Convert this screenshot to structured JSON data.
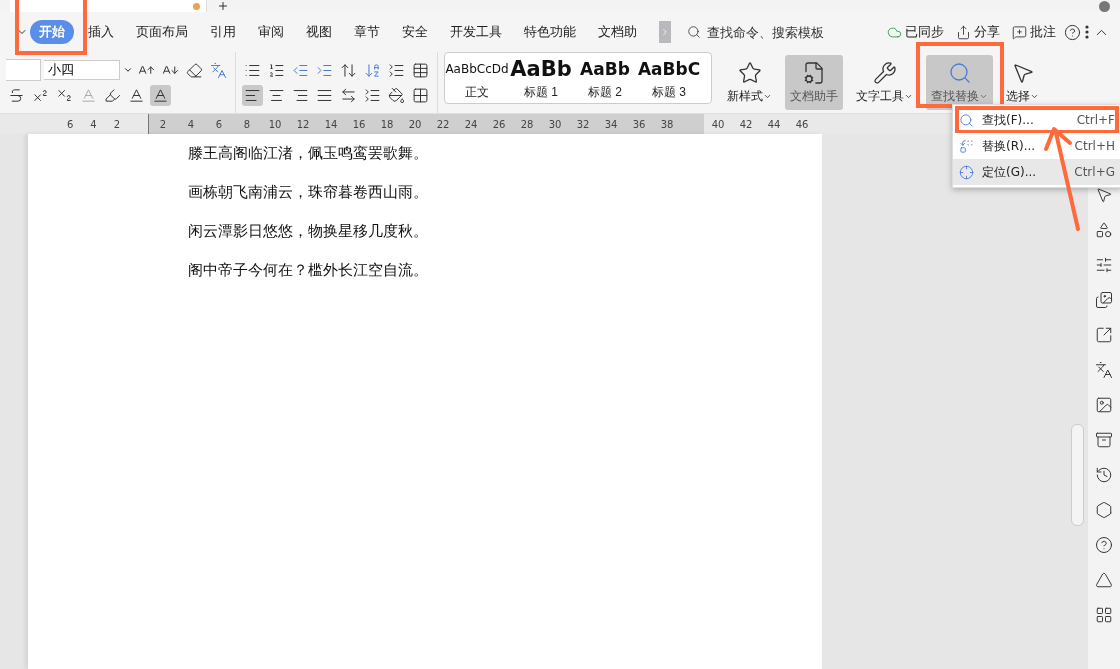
{
  "menu_tabs": [
    {
      "label": "开始",
      "selected": true,
      "highlighted": true
    },
    {
      "label": "插入",
      "selected": false,
      "highlighted": false
    },
    {
      "label": "页面布局",
      "selected": false,
      "highlighted": false
    },
    {
      "label": "引用",
      "selected": false,
      "highlighted": false
    },
    {
      "label": "审阅",
      "selected": false,
      "highlighted": false
    },
    {
      "label": "视图",
      "selected": false,
      "highlighted": false
    },
    {
      "label": "章节",
      "selected": false,
      "highlighted": false
    },
    {
      "label": "安全",
      "selected": false,
      "highlighted": false
    },
    {
      "label": "开发工具",
      "selected": false,
      "highlighted": false
    },
    {
      "label": "特色功能",
      "selected": false,
      "highlighted": false
    },
    {
      "label": "文档助",
      "selected": false,
      "highlighted": false
    }
  ],
  "search": {
    "placeholder": "查找命令、搜索模板"
  },
  "header_actions": [
    {
      "label": "已同步"
    },
    {
      "label": "分享"
    },
    {
      "label": "批注"
    }
  ],
  "font_size": {
    "value": "小四"
  },
  "alignment_buttons": [
    {
      "selected": true
    },
    {
      "selected": false
    },
    {
      "selected": false
    },
    {
      "selected": false
    },
    {
      "selected": false
    }
  ],
  "styles": [
    {
      "preview": "AaBbCcDd",
      "label": "正文",
      "kind": "body"
    },
    {
      "preview": "AaBb",
      "label": "标题 1",
      "kind": "title"
    },
    {
      "preview": "AaBb",
      "label": "标题 2",
      "kind": "heading"
    },
    {
      "preview": "AaBbC",
      "label": "标题 3",
      "kind": "heading"
    }
  ],
  "big_buttons": [
    {
      "label": "新样式",
      "selected": false,
      "highlighted": false,
      "dropdown": true
    },
    {
      "label": "文档助手",
      "selected": true,
      "highlighted": false,
      "dropdown": false
    },
    {
      "label": "文字工具",
      "selected": false,
      "highlighted": false,
      "dropdown": true
    },
    {
      "label": "查找替换",
      "selected": true,
      "highlighted": true,
      "dropdown": true
    },
    {
      "label": "选择",
      "selected": false,
      "highlighted": false,
      "dropdown": true
    }
  ],
  "ruler": {
    "left_marks": [
      "6",
      "4",
      "2"
    ],
    "marks": [
      "2",
      "4",
      "6",
      "8",
      "10",
      "12",
      "14",
      "16",
      "18",
      "20",
      "22",
      "24",
      "26",
      "28",
      "30",
      "32",
      "34",
      "36",
      "38",
      "40",
      "42",
      "44",
      "46"
    ]
  },
  "document": {
    "lines": [
      "滕王高阁临江渚，佩玉鸣鸾罢歌舞。",
      "画栋朝飞南浦云，珠帘暮卷西山雨。",
      "闲云潭影日悠悠，物换星移几度秋。",
      "阁中帝子今何在？槛外长江空自流。"
    ]
  },
  "dropdown_menu": [
    {
      "label": "查找(F)...",
      "shortcut": "Ctrl+F",
      "selected": false,
      "highlighted": true
    },
    {
      "label": "替换(R)...",
      "shortcut": "Ctrl+H",
      "selected": false,
      "highlighted": false
    },
    {
      "label": "定位(G)...",
      "shortcut": "Ctrl+G",
      "selected": true,
      "highlighted": false
    }
  ]
}
